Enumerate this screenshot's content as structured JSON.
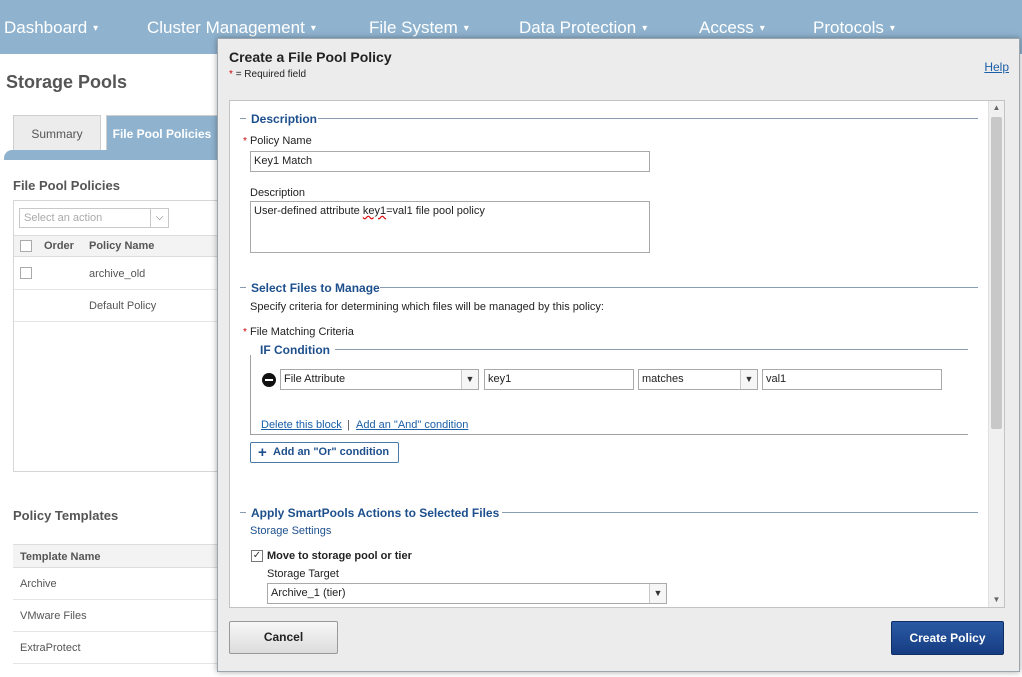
{
  "nav": {
    "items": [
      "Dashboard",
      "Cluster Management",
      "File System",
      "Data Protection",
      "Access",
      "Protocols"
    ],
    "caret": "▾"
  },
  "background": {
    "page_title": "Storage Pools",
    "tabs": [
      "Summary",
      "File Pool Policies"
    ],
    "policies_heading": "File Pool Policies",
    "action_placeholder": "Select an action",
    "table_headers": [
      "Order",
      "Policy Name"
    ],
    "policies": [
      "archive_old",
      "Default Policy"
    ],
    "templates_heading": "Policy Templates",
    "templates_header": "Template Name",
    "templates": [
      "Archive",
      "VMware Files",
      "ExtraProtect"
    ]
  },
  "dialog": {
    "title": "Create a File Pool Policy",
    "required_note": "= Required field",
    "help": "Help",
    "description_section": "Description",
    "policy_name_label": "Policy Name",
    "policy_name_value": "Key1 Match",
    "description_label": "Description",
    "description_pre": "User-defined attribute ",
    "description_key": "key1",
    "description_post": "=val1 file pool policy",
    "select_files_section": "Select Files to Manage",
    "select_files_desc": "Specify criteria for determining which files will be managed by this policy:",
    "criteria_label": "File Matching Criteria",
    "if_condition": "IF Condition",
    "attribute_type": "File Attribute",
    "attribute_key": "key1",
    "operator": "matches",
    "attribute_value": "val1",
    "delete_block": "Delete this block",
    "separator": "|",
    "add_and": "Add an \"And\" condition",
    "add_or": "Add an \"Or\" condition",
    "actions_section": "Apply SmartPools Actions to Selected Files",
    "storage_settings": "Storage Settings",
    "move_checkbox": "Move to storage pool or tier",
    "move_checked": true,
    "storage_target_label": "Storage Target",
    "storage_target_value": "Archive_1 (tier)",
    "cancel": "Cancel",
    "create": "Create Policy"
  }
}
